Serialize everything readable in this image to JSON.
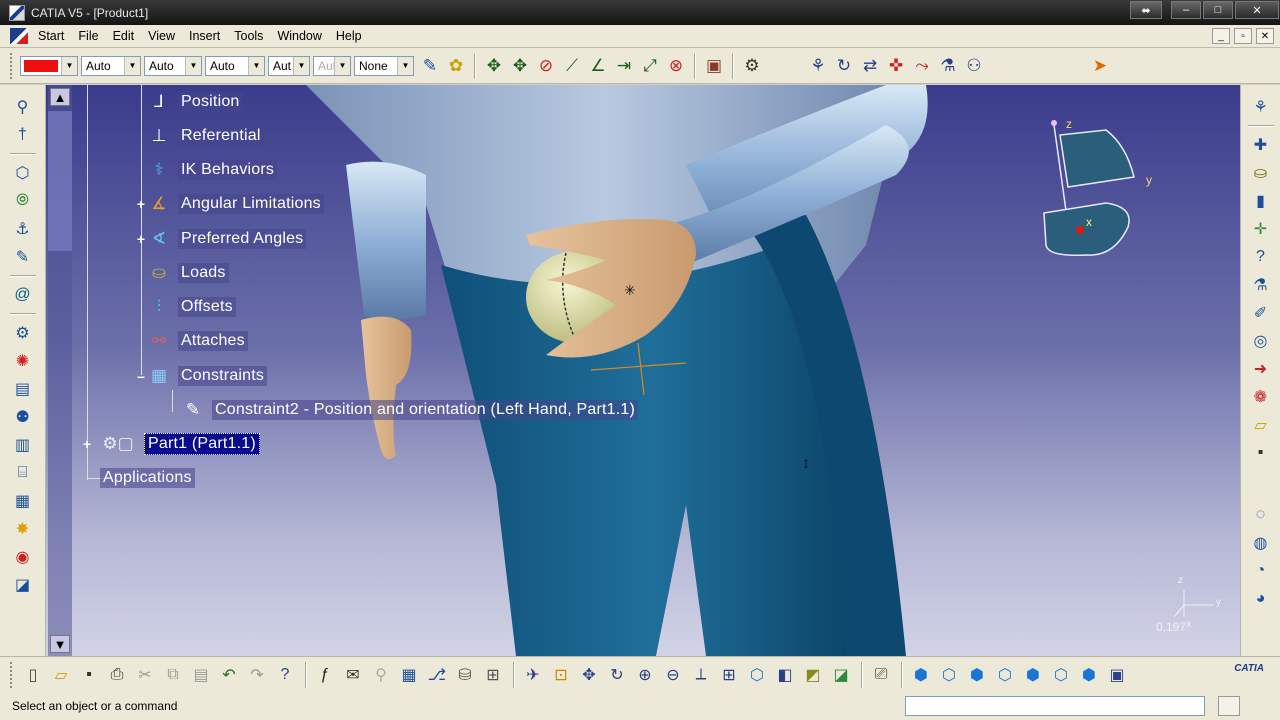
{
  "window": {
    "title": "CATIA V5 - [Product1]",
    "buttons": [
      "⬌",
      "–",
      "□",
      "✕"
    ]
  },
  "menu": {
    "items": [
      "Start",
      "File",
      "Edit",
      "View",
      "Insert",
      "Tools",
      "Window",
      "Help"
    ],
    "mdi_buttons": [
      "_",
      "▫",
      "✕"
    ]
  },
  "toolbar_top": {
    "color_value": "#ee1010",
    "combos": [
      {
        "name": "linetype-combo",
        "value": "Auto"
      },
      {
        "name": "thickness-combo",
        "value": "Auto"
      },
      {
        "name": "layer-combo",
        "value": "Auto"
      },
      {
        "name": "auto-combo-4",
        "value": "Aut"
      },
      {
        "name": "auto-combo-5",
        "value": "Aut"
      },
      {
        "name": "layer-none-combo",
        "value": "None"
      }
    ]
  },
  "tree": {
    "nodes": [
      {
        "label": "Position",
        "icon": "position-icon"
      },
      {
        "label": "Referential",
        "icon": "referential-icon"
      },
      {
        "label": "IK Behaviors",
        "icon": "ik-behaviors-icon"
      },
      {
        "label": "Angular Limitations",
        "icon": "angular-limitations-icon"
      },
      {
        "label": "Preferred Angles",
        "icon": "preferred-angles-icon"
      },
      {
        "label": "Loads",
        "icon": "loads-icon"
      },
      {
        "label": "Offsets",
        "icon": "offsets-icon"
      },
      {
        "label": "Attaches",
        "icon": "attaches-icon"
      },
      {
        "label": "Constraints",
        "icon": "constraints-icon"
      },
      {
        "label": "Constraint2 - Position and orientation (Left Hand, Part1.1)",
        "icon": "constraint-icon"
      },
      {
        "label": "Part1 (Part1.1)",
        "icon": "part-icon"
      },
      {
        "label": "Applications",
        "icon": ""
      }
    ]
  },
  "compass": {
    "axes": [
      "z",
      "y",
      "x"
    ]
  },
  "mini_axis": {
    "labels": [
      "z",
      "y",
      "x"
    ],
    "zoom": "0.197"
  },
  "status": {
    "message": "Select an object or a command"
  },
  "brand": {
    "logo_text": "CATIA"
  }
}
